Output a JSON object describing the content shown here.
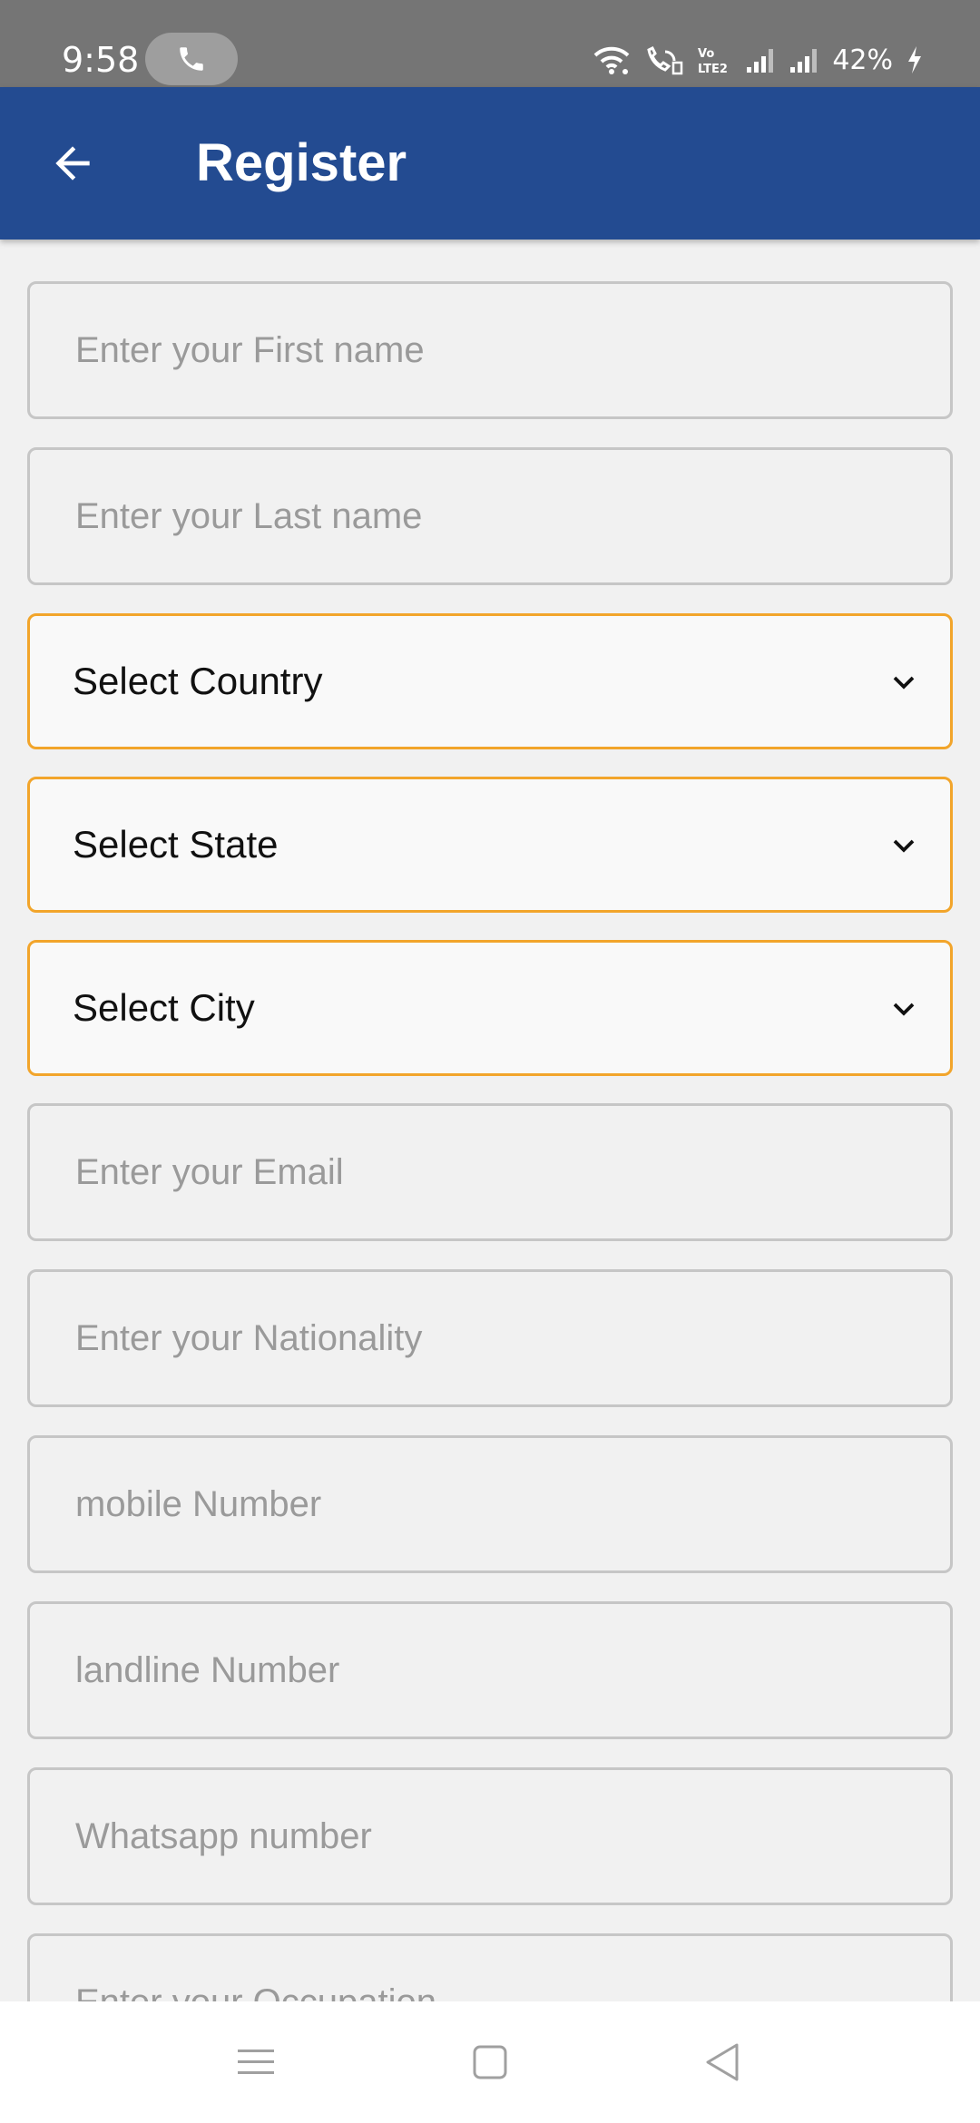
{
  "status_bar": {
    "time": "9:58",
    "battery": "42%",
    "icons": [
      "phone-call-icon",
      "wifi-icon",
      "wifi-calling-icon",
      "volte-icon",
      "signal-icon",
      "signal-icon",
      "charging-icon"
    ]
  },
  "header": {
    "title": "Register",
    "back_icon": "arrow-left-icon"
  },
  "form": {
    "first_name_placeholder": "Enter your First name",
    "last_name_placeholder": "Enter your Last name",
    "country_label": "Select Country",
    "state_label": "Select State",
    "city_label": "Select City",
    "email_placeholder": "Enter your Email",
    "nationality_placeholder": "Enter your Nationality",
    "mobile_placeholder": "mobile Number",
    "landline_placeholder": "landline Number",
    "whatsapp_placeholder": "Whatsapp number",
    "occupation_placeholder": "Enter your Occupation"
  },
  "nav_bar": {
    "icons": [
      "menu-icon",
      "home-square-icon",
      "back-triangle-icon"
    ]
  },
  "colors": {
    "status_bar": "#757575",
    "app_bar": "#234b91",
    "dropdown_border": "#f2a52b",
    "field_border": "#c6c6c6",
    "background": "#f1f1f1"
  }
}
